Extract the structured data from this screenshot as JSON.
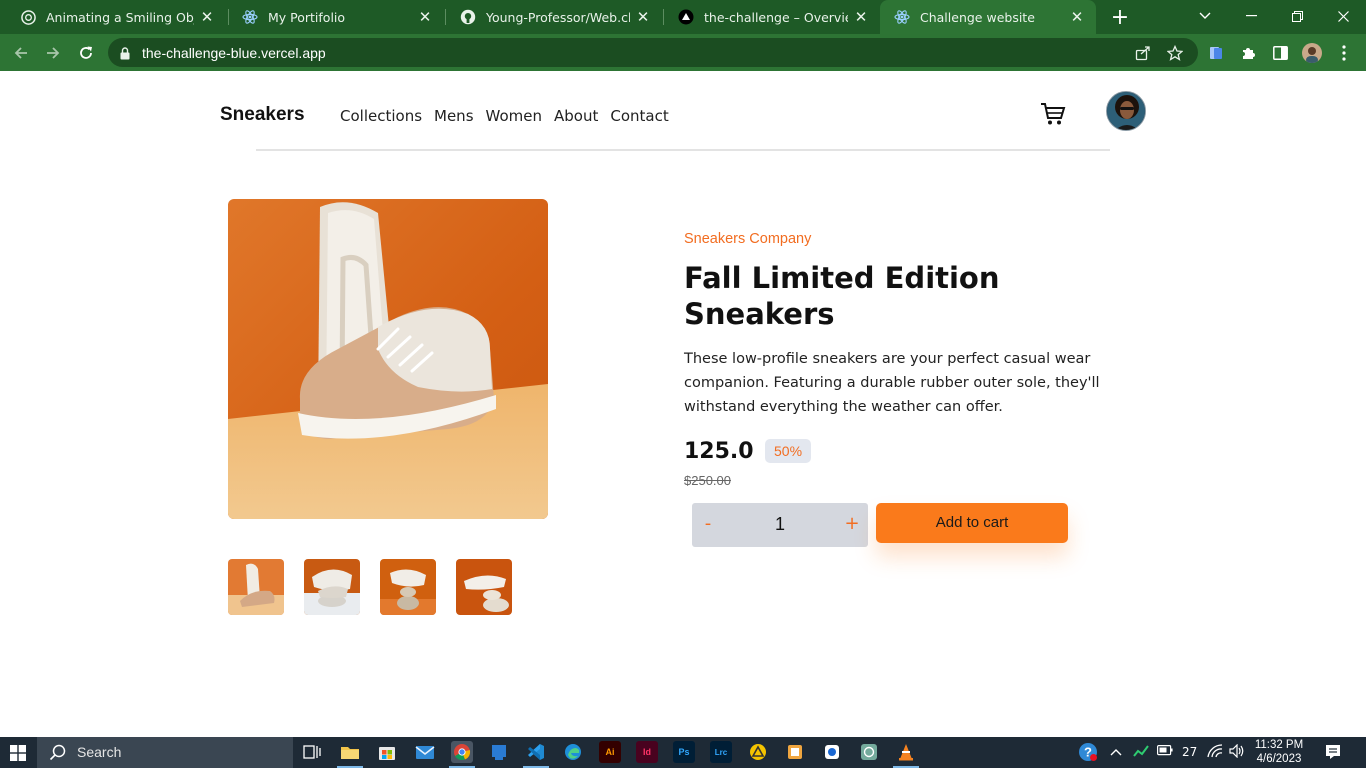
{
  "browser": {
    "tabs": [
      {
        "title": "Animating a Smiling Object",
        "icon": "chatgpt-icon"
      },
      {
        "title": "My Portifolio",
        "icon": "react-icon"
      },
      {
        "title": "Young-Professor/Web.challenge",
        "icon": "github-icon"
      },
      {
        "title": "the-challenge – Overview – Vercel",
        "icon": "vercel-icon"
      },
      {
        "title": "Challenge website",
        "icon": "react-icon",
        "active": true
      }
    ],
    "url": "the-challenge-blue.vercel.app"
  },
  "site": {
    "brand": "Sneakers",
    "nav": [
      "Collections",
      "Mens",
      "Women",
      "About",
      "Contact"
    ]
  },
  "product": {
    "company": "Sneakers Company",
    "title": "Fall Limited Edition Sneakers",
    "description": "These low-profile sneakers are your perfect casual wear companion. Featuring a durable rubber outer sole, they'll withstand everything the weather can offer.",
    "price": "125.0",
    "discount": "50%",
    "old_price": "$250.00",
    "quantity": "1",
    "minus": "-",
    "plus": "+",
    "add_to_cart": "Add to cart"
  },
  "colors": {
    "accent": "#fa7a1b",
    "chrome_green": "#2d7434"
  },
  "taskbar": {
    "search_label": "Search",
    "apps": [
      "task-view-icon",
      "file-explorer-icon",
      "ms-store-icon",
      "mail-icon",
      "chrome-icon",
      "app-icon",
      "vscode-icon",
      "edge-icon",
      "illustrator-icon",
      "indesign-icon",
      "photoshop-icon",
      "lightroom-icon",
      "autocad-icon",
      "app-icon",
      "app-icon",
      "chatgpt-icon",
      "vlc-icon"
    ],
    "ai_label": "Ai",
    "id_label": "Id",
    "ps_label": "Ps",
    "lrc_label": "Lrc",
    "temperature": "27",
    "time": "11:32 PM",
    "date": "4/6/2023"
  }
}
